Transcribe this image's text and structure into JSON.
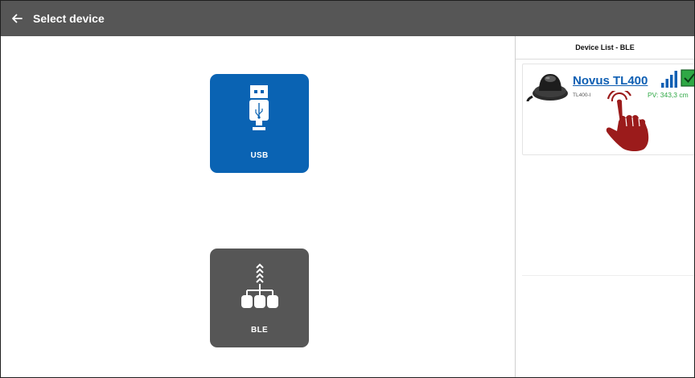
{
  "header": {
    "title": "Select device",
    "back_icon": "arrow-left-icon"
  },
  "connection_types": [
    {
      "label": "USB",
      "icon": "usb-icon",
      "color": "#0a63b3"
    },
    {
      "label": "BLE",
      "icon": "network-tree-icon",
      "color": "#565656"
    }
  ],
  "device_list": {
    "title": "Device List - BLE",
    "devices": [
      {
        "name": "Novus TL400",
        "model": "TL400-I",
        "pv": "PV: 343,3 cm",
        "signal_icon": "signal-bars-icon",
        "status_icon": "check-icon",
        "status_color": "#2fa845"
      }
    ]
  },
  "overlay": {
    "icon": "pointing-hand-icon",
    "color": "#9b1b1b"
  }
}
